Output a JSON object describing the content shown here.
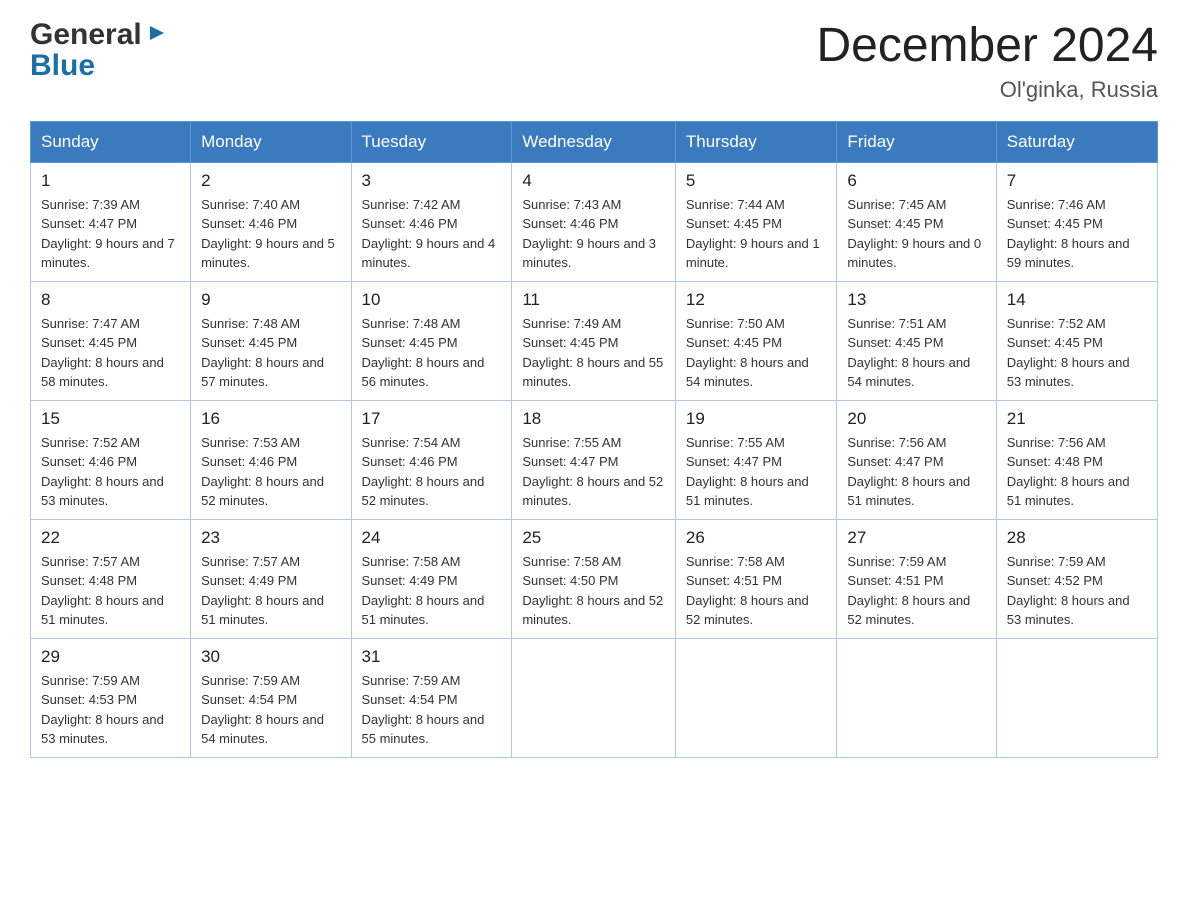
{
  "logo": {
    "general": "General",
    "blue": "Blue",
    "arrow": "▶"
  },
  "title": "December 2024",
  "location": "Ol'ginka, Russia",
  "weekdays": [
    "Sunday",
    "Monday",
    "Tuesday",
    "Wednesday",
    "Thursday",
    "Friday",
    "Saturday"
  ],
  "weeks": [
    [
      {
        "day": "1",
        "sunrise": "7:39 AM",
        "sunset": "4:47 PM",
        "daylight": "9 hours and 7 minutes."
      },
      {
        "day": "2",
        "sunrise": "7:40 AM",
        "sunset": "4:46 PM",
        "daylight": "9 hours and 5 minutes."
      },
      {
        "day": "3",
        "sunrise": "7:42 AM",
        "sunset": "4:46 PM",
        "daylight": "9 hours and 4 minutes."
      },
      {
        "day": "4",
        "sunrise": "7:43 AM",
        "sunset": "4:46 PM",
        "daylight": "9 hours and 3 minutes."
      },
      {
        "day": "5",
        "sunrise": "7:44 AM",
        "sunset": "4:45 PM",
        "daylight": "9 hours and 1 minute."
      },
      {
        "day": "6",
        "sunrise": "7:45 AM",
        "sunset": "4:45 PM",
        "daylight": "9 hours and 0 minutes."
      },
      {
        "day": "7",
        "sunrise": "7:46 AM",
        "sunset": "4:45 PM",
        "daylight": "8 hours and 59 minutes."
      }
    ],
    [
      {
        "day": "8",
        "sunrise": "7:47 AM",
        "sunset": "4:45 PM",
        "daylight": "8 hours and 58 minutes."
      },
      {
        "day": "9",
        "sunrise": "7:48 AM",
        "sunset": "4:45 PM",
        "daylight": "8 hours and 57 minutes."
      },
      {
        "day": "10",
        "sunrise": "7:48 AM",
        "sunset": "4:45 PM",
        "daylight": "8 hours and 56 minutes."
      },
      {
        "day": "11",
        "sunrise": "7:49 AM",
        "sunset": "4:45 PM",
        "daylight": "8 hours and 55 minutes."
      },
      {
        "day": "12",
        "sunrise": "7:50 AM",
        "sunset": "4:45 PM",
        "daylight": "8 hours and 54 minutes."
      },
      {
        "day": "13",
        "sunrise": "7:51 AM",
        "sunset": "4:45 PM",
        "daylight": "8 hours and 54 minutes."
      },
      {
        "day": "14",
        "sunrise": "7:52 AM",
        "sunset": "4:45 PM",
        "daylight": "8 hours and 53 minutes."
      }
    ],
    [
      {
        "day": "15",
        "sunrise": "7:52 AM",
        "sunset": "4:46 PM",
        "daylight": "8 hours and 53 minutes."
      },
      {
        "day": "16",
        "sunrise": "7:53 AM",
        "sunset": "4:46 PM",
        "daylight": "8 hours and 52 minutes."
      },
      {
        "day": "17",
        "sunrise": "7:54 AM",
        "sunset": "4:46 PM",
        "daylight": "8 hours and 52 minutes."
      },
      {
        "day": "18",
        "sunrise": "7:55 AM",
        "sunset": "4:47 PM",
        "daylight": "8 hours and 52 minutes."
      },
      {
        "day": "19",
        "sunrise": "7:55 AM",
        "sunset": "4:47 PM",
        "daylight": "8 hours and 51 minutes."
      },
      {
        "day": "20",
        "sunrise": "7:56 AM",
        "sunset": "4:47 PM",
        "daylight": "8 hours and 51 minutes."
      },
      {
        "day": "21",
        "sunrise": "7:56 AM",
        "sunset": "4:48 PM",
        "daylight": "8 hours and 51 minutes."
      }
    ],
    [
      {
        "day": "22",
        "sunrise": "7:57 AM",
        "sunset": "4:48 PM",
        "daylight": "8 hours and 51 minutes."
      },
      {
        "day": "23",
        "sunrise": "7:57 AM",
        "sunset": "4:49 PM",
        "daylight": "8 hours and 51 minutes."
      },
      {
        "day": "24",
        "sunrise": "7:58 AM",
        "sunset": "4:49 PM",
        "daylight": "8 hours and 51 minutes."
      },
      {
        "day": "25",
        "sunrise": "7:58 AM",
        "sunset": "4:50 PM",
        "daylight": "8 hours and 52 minutes."
      },
      {
        "day": "26",
        "sunrise": "7:58 AM",
        "sunset": "4:51 PM",
        "daylight": "8 hours and 52 minutes."
      },
      {
        "day": "27",
        "sunrise": "7:59 AM",
        "sunset": "4:51 PM",
        "daylight": "8 hours and 52 minutes."
      },
      {
        "day": "28",
        "sunrise": "7:59 AM",
        "sunset": "4:52 PM",
        "daylight": "8 hours and 53 minutes."
      }
    ],
    [
      {
        "day": "29",
        "sunrise": "7:59 AM",
        "sunset": "4:53 PM",
        "daylight": "8 hours and 53 minutes."
      },
      {
        "day": "30",
        "sunrise": "7:59 AM",
        "sunset": "4:54 PM",
        "daylight": "8 hours and 54 minutes."
      },
      {
        "day": "31",
        "sunrise": "7:59 AM",
        "sunset": "4:54 PM",
        "daylight": "8 hours and 55 minutes."
      },
      null,
      null,
      null,
      null
    ]
  ],
  "labels": {
    "sunrise": "Sunrise:",
    "sunset": "Sunset:",
    "daylight": "Daylight:"
  }
}
